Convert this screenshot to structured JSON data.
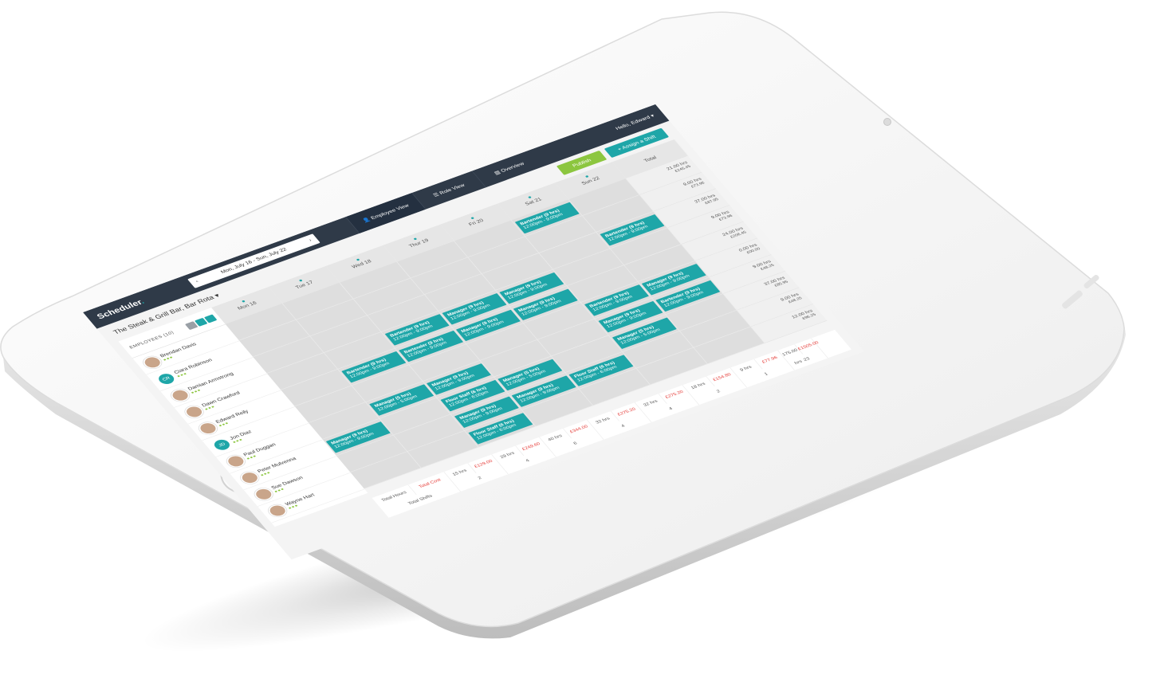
{
  "app": {
    "logo": "Scheduler",
    "logo_dot": ".",
    "greeting": "Hello, Edward ▾",
    "business": "The Steak & Grill Bar, Bar Rota ▾"
  },
  "date_range": {
    "prev": "‹",
    "label": "Mon, July 16 - Sun, July 22",
    "next": "›"
  },
  "tabs": [
    {
      "label": "Employee View"
    },
    {
      "label": "Role View"
    },
    {
      "label": "Overview"
    }
  ],
  "actions": {
    "publish": "Publish",
    "assign_shift": "+ Assign a Shift"
  },
  "employees_header": "EMPLOYEES (10)",
  "days": [
    "Mon 16",
    "Tue 17",
    "Wed 18",
    "Thur 19",
    "Fri 20",
    "Sat 21",
    "Sun 22"
  ],
  "total_header": "Total",
  "employees": [
    {
      "name": "Brendan Davis",
      "initials": "",
      "hours": "21.00 hrs",
      "cost": "£245.45"
    },
    {
      "name": "Ciara Robinson",
      "initials": "CR",
      "hours": "9.00 hrs",
      "cost": "£73.96"
    },
    {
      "name": "Damian Armstrong",
      "initials": "",
      "hours": "37.00 hrs",
      "cost": "£87.95"
    },
    {
      "name": "Dawn Crawford",
      "initials": "",
      "hours": "9.00 hrs",
      "cost": "£73.96"
    },
    {
      "name": "Edward Reily",
      "initials": "",
      "hours": "24.00 hrs",
      "cost": "£206.45"
    },
    {
      "name": "Jon Diaz",
      "initials": "JD",
      "hours": "0.00 hrs",
      "cost": "£00.00"
    },
    {
      "name": "Paul Duggan",
      "initials": "",
      "hours": "9.00 hrs",
      "cost": "£48.25"
    },
    {
      "name": "Peter Mulvenna",
      "initials": "",
      "hours": "37.00 hrs",
      "cost": "£85.95"
    },
    {
      "name": "Sue Dawson",
      "initials": "",
      "hours": "9.00 hrs",
      "cost": "£48.25"
    },
    {
      "name": "Wayne Hart",
      "initials": "",
      "hours": "12.00 hrs",
      "cost": "£96.25"
    }
  ],
  "shifts": [
    {
      "row": 0,
      "day": 5,
      "role": "Bartender (9 hrs)",
      "time": "12:00pm - 9:00pm"
    },
    {
      "row": 2,
      "day": 6,
      "role": "Bartender (9 hrs)",
      "time": "12:00pm - 9:00pm"
    },
    {
      "row": 3,
      "day": 2,
      "role": "Bartender (9 hrs)",
      "time": "12:00pm - 9:00pm"
    },
    {
      "row": 3,
      "day": 3,
      "role": "Manager (9 hrs)",
      "time": "12:00pm - 9:00pm"
    },
    {
      "row": 3,
      "day": 4,
      "role": "Manager (9 hrs)",
      "time": "12:00pm - 9:00pm"
    },
    {
      "row": 4,
      "day": 1,
      "role": "Bartender (9 hrs)",
      "time": "12:00pm - 9:00pm"
    },
    {
      "row": 4,
      "day": 2,
      "role": "Bartender (9 hrs)",
      "time": "12:00pm - 9:00pm"
    },
    {
      "row": 4,
      "day": 3,
      "role": "Manager (9 hrs)",
      "time": "12:00pm - 9:00pm"
    },
    {
      "row": 4,
      "day": 4,
      "role": "Manager (9 hrs)",
      "time": "12:00pm - 9:00pm"
    },
    {
      "row": 5,
      "day": 5,
      "role": "Bartender (9 hrs)",
      "time": "12:00pm - 9:00pm"
    },
    {
      "row": 5,
      "day": 6,
      "role": "Manager (9 hrs)",
      "time": "12:00pm - 9:00pm"
    },
    {
      "row": 6,
      "day": 1,
      "role": "Manager (5 hrs)",
      "time": "12:00pm - 5:00pm"
    },
    {
      "row": 6,
      "day": 2,
      "role": "Manager (9 hrs)",
      "time": "12:00pm - 9:00pm"
    },
    {
      "row": 6,
      "day": 5,
      "role": "Manager (9 hrs)",
      "time": "12:00pm - 9:00pm"
    },
    {
      "row": 6,
      "day": 6,
      "role": "Bartender (9 hrs)",
      "time": "12:00pm - 9:00pm"
    },
    {
      "row": 7,
      "day": 0,
      "role": "Manager (9 hrs)",
      "time": "12:00pm - 9:00pm"
    },
    {
      "row": 7,
      "day": 2,
      "role": "Floor Staff (6 hrs)",
      "time": "12:00pm - 6:00pm"
    },
    {
      "row": 7,
      "day": 3,
      "role": "Manager (5 hrs)",
      "time": "12:00pm - 5:00pm"
    },
    {
      "row": 7,
      "day": 5,
      "role": "Manager (5 hrs)",
      "time": "12:00pm - 5:00pm"
    },
    {
      "row": 8,
      "day": 2,
      "role": "Manager (9 hrs)",
      "time": "12:00pm - 9:00pm"
    },
    {
      "row": 8,
      "day": 3,
      "role": "Manager (9 hrs)",
      "time": "12:00pm - 9:00pm"
    },
    {
      "row": 8,
      "day": 4,
      "role": "Floor Staff (6 hrs)",
      "time": "12:00pm - 6:00pm"
    },
    {
      "row": 9,
      "day": 2,
      "role": "Floor Staff (6 hrs)",
      "time": "12:00pm - 6:00pm"
    }
  ],
  "footer": {
    "total_hours_label": "Total Hours",
    "total_cost_label": "Total Cost",
    "total_shifts_label": "Total Shifts",
    "days": [
      {
        "hours": "15 hrs",
        "cost": "£129.00",
        "shifts": "2"
      },
      {
        "hours": "29 hrs",
        "cost": "£249.60",
        "shifts": "4"
      },
      {
        "hours": "40 hrs",
        "cost": "£344.00",
        "shifts": "6"
      },
      {
        "hours": "32 hrs",
        "cost": "£275.20",
        "shifts": "4"
      },
      {
        "hours": "32 hrs",
        "cost": "£275.20",
        "shifts": "4"
      },
      {
        "hours": "18 hrs",
        "cost": "£154.80",
        "shifts": "2"
      },
      {
        "hours": "9 hrs",
        "cost": "£77.96",
        "shifts": "1"
      }
    ],
    "week_hours": "175.00 hrs",
    "week_cost": "£1505.00",
    "week_shifts": "23"
  },
  "colors": {
    "accent": "#1ea6a8",
    "publish": "#8cc63f",
    "topbar": "#2f3a48",
    "cost_red": "#e53935"
  },
  "icons": {
    "employee_view": "user-icon",
    "role_view": "list-icon",
    "overview": "chart-icon"
  }
}
